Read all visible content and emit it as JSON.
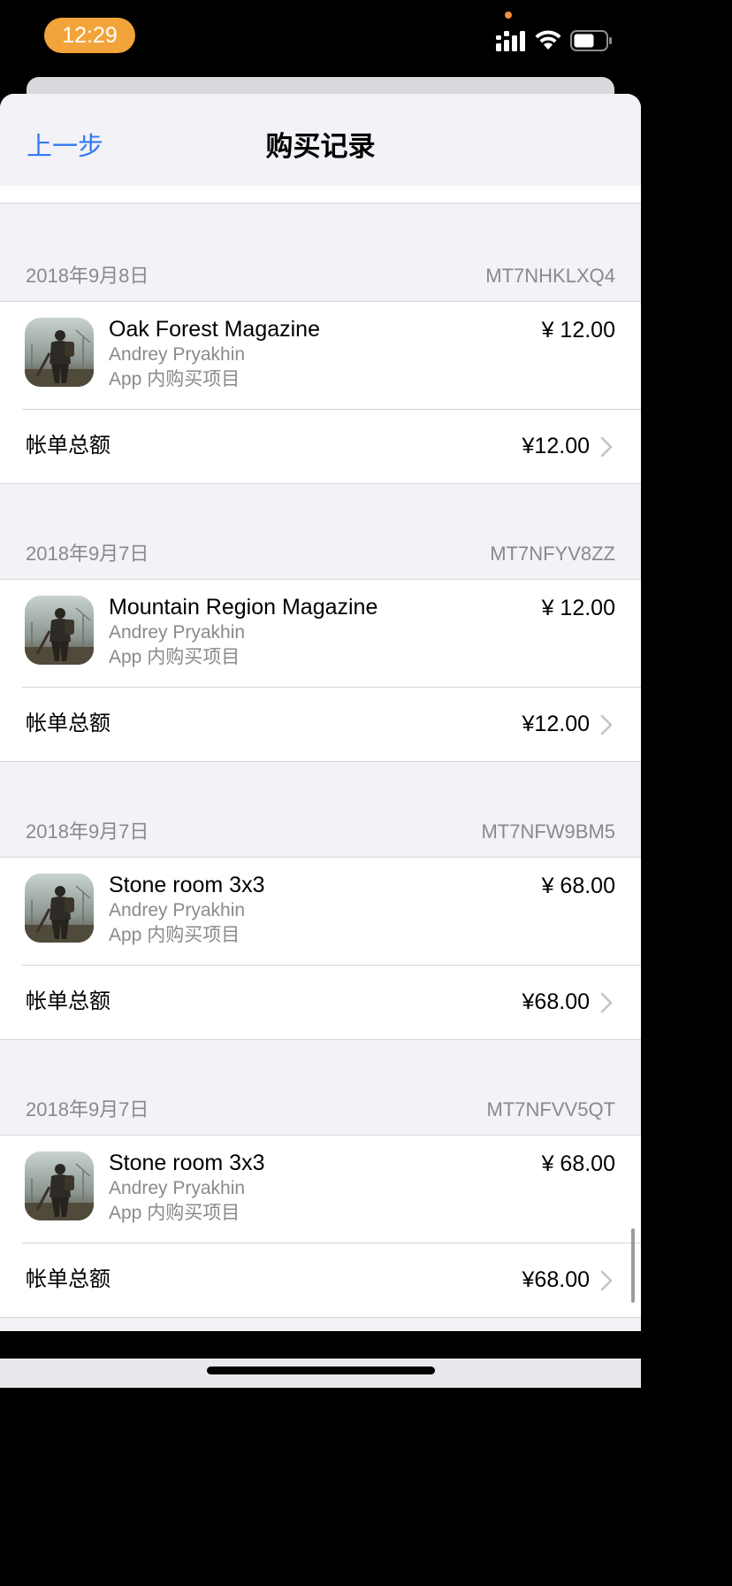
{
  "status_bar": {
    "time": "12:29"
  },
  "nav": {
    "back_label": "上一步",
    "title": "购买记录"
  },
  "purchases": [
    {
      "date": "2018年9月8日",
      "order_id": "MT7NHKLXQ4",
      "item_name": "Oak Forest Magazine",
      "developer": "Andrey Pryakhin",
      "type": "App 内购买项目",
      "price": "¥ 12.00",
      "total_label": "帐单总额",
      "total": "¥12.00"
    },
    {
      "date": "2018年9月7日",
      "order_id": "MT7NFYV8ZZ",
      "item_name": "Mountain Region Magazine",
      "developer": "Andrey Pryakhin",
      "type": "App 内购买项目",
      "price": "¥ 12.00",
      "total_label": "帐单总额",
      "total": "¥12.00"
    },
    {
      "date": "2018年9月7日",
      "order_id": "MT7NFW9BM5",
      "item_name": "Stone room 3x3",
      "developer": "Andrey Pryakhin",
      "type": "App 内购买项目",
      "price": "¥ 68.00",
      "total_label": "帐单总额",
      "total": "¥68.00"
    },
    {
      "date": "2018年9月7日",
      "order_id": "MT7NFVV5QT",
      "item_name": "Stone room 3x3",
      "developer": "Andrey Pryakhin",
      "type": "App 内购买项目",
      "price": "¥ 68.00",
      "total_label": "帐单总额",
      "total": "¥68.00"
    }
  ],
  "colors": {
    "accent": "#3478f6",
    "time_pill": "#f2a43b",
    "background": "#f2f2f7",
    "secondary_text": "#8a8a8e"
  },
  "icons": {
    "app_icon": "survivor-game-app-icon",
    "chevron": "chevron-right-icon"
  }
}
